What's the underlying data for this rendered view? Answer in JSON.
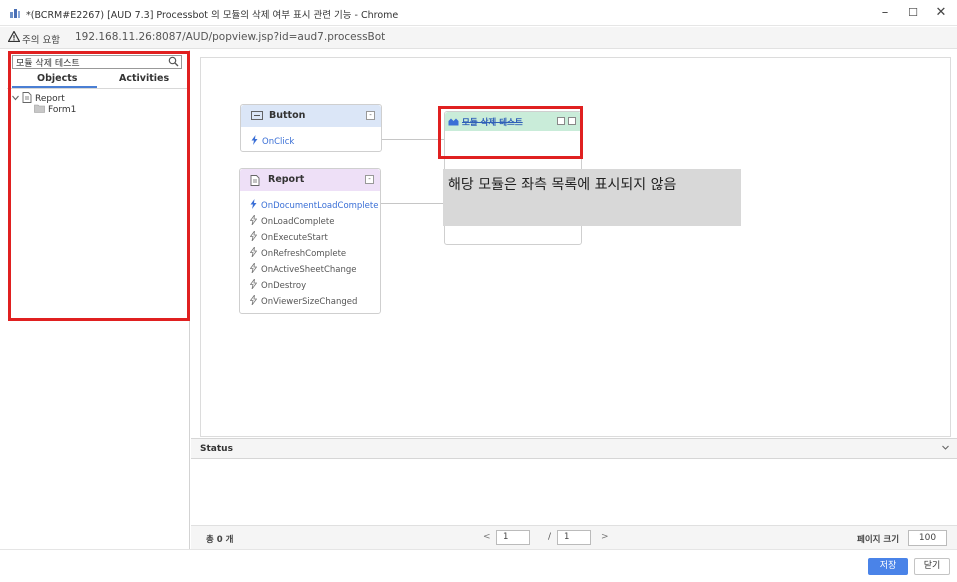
{
  "window": {
    "title": "*(BCRM#E2267) [AUD 7.3] Processbot 의 모듈의 삭제 여부 표시 관련 기능 - Chrome",
    "controls": {
      "minimize": "–",
      "maximize": "☐",
      "close": "✕"
    }
  },
  "address_bar": {
    "warning": "주의 요함",
    "url": "192.168.11.26:8087/AUD/popview.jsp?id=aud7.processBot"
  },
  "sidebar": {
    "search_value": "모듈 삭제 테스트",
    "tabs": [
      {
        "label": "Objects",
        "active": true
      },
      {
        "label": "Activities",
        "active": false
      }
    ],
    "tree": [
      {
        "label": "Report",
        "expanded": true
      },
      {
        "label": "Form1"
      }
    ]
  },
  "nodes": {
    "button": {
      "title": "Button",
      "collapse": "-",
      "events": [
        "OnClick"
      ]
    },
    "report": {
      "title": "Report",
      "collapse": "-",
      "events": [
        "OnDocumentLoadComplete",
        "OnLoadComplete",
        "OnExecuteStart",
        "OnRefreshComplete",
        "OnActiveSheetChange",
        "OnDestroy",
        "OnViewerSizeChanged"
      ]
    },
    "deleted_module": {
      "title": "모듈 삭제 테스트"
    }
  },
  "annotation": {
    "text": "해당 모듈은 좌측 목록에 표시되지 않음"
  },
  "status": {
    "label": "Status"
  },
  "pager": {
    "total": "총 0 개",
    "prev": "<",
    "next": ">",
    "current_page": "1",
    "slash": "/",
    "total_pages": "1",
    "page_size_label": "페이지 크기",
    "page_size": "100"
  },
  "footer": {
    "save": "저장",
    "close": "닫기"
  },
  "colors": {
    "highlight_red": "#e02020",
    "button_header": "#dbe6f7",
    "report_header": "#eee0f7",
    "module_header": "#c9ecd9",
    "active_event": "#3a6fd6",
    "save_button": "#4a83e8"
  }
}
